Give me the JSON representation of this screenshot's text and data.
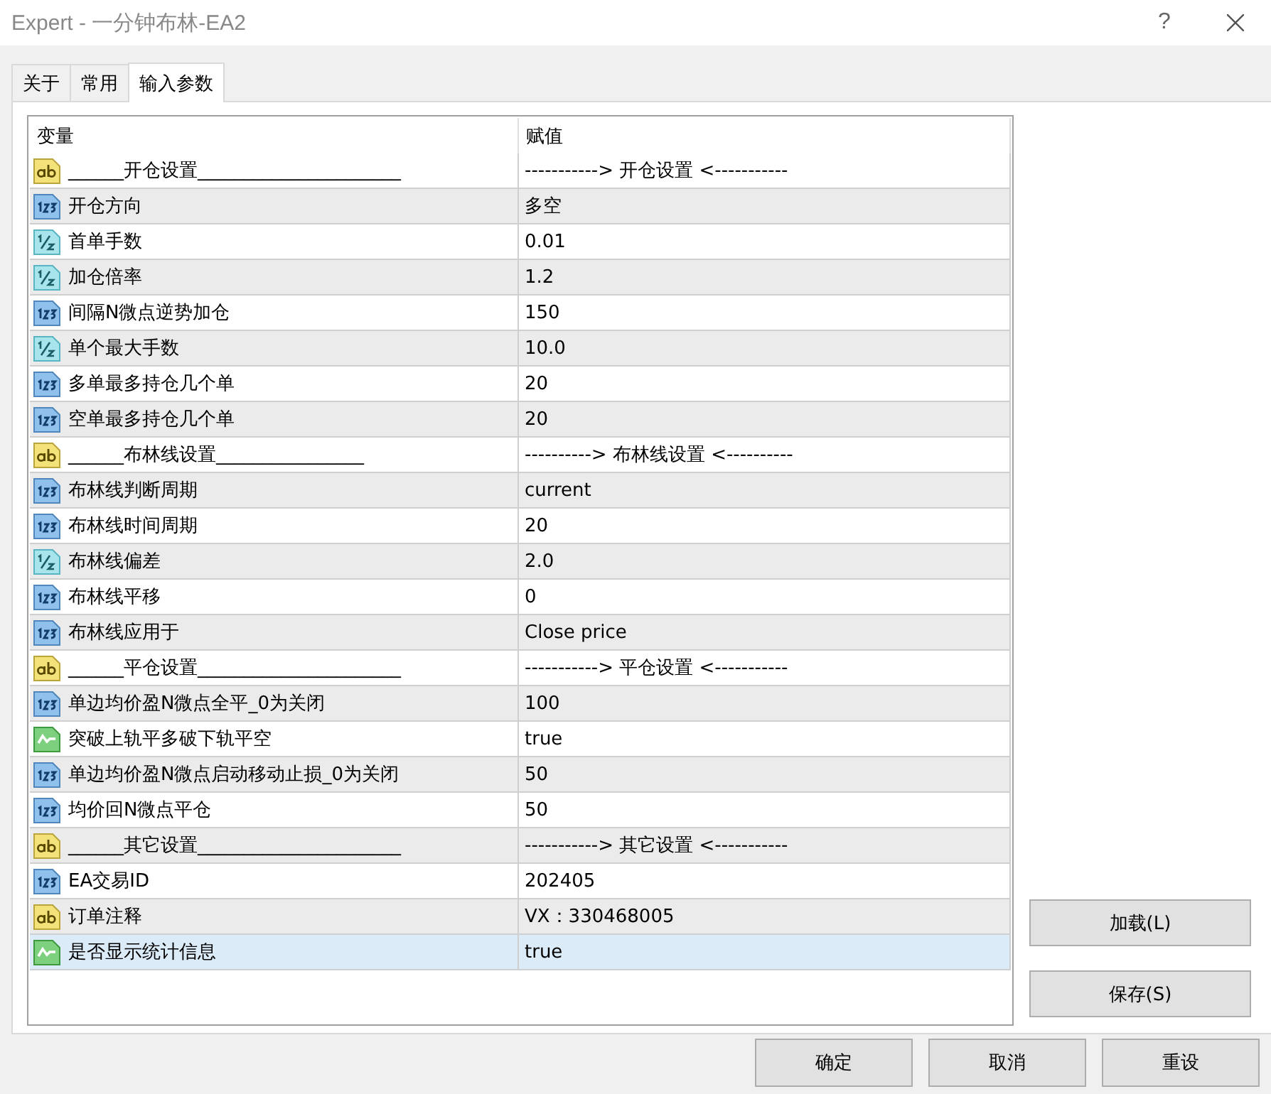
{
  "window": {
    "title": "Expert - 一分钟布林-EA2",
    "help": "?"
  },
  "tabs": [
    {
      "label": "关于",
      "selected": false
    },
    {
      "label": "常用",
      "selected": false
    },
    {
      "label": "输入参数",
      "selected": true
    }
  ],
  "table": {
    "columns": [
      "变量",
      "赋值"
    ],
    "rows": [
      {
        "kind": "string",
        "name": "______开仓设置______________________",
        "value": "-----------> 开仓设置 <-----------",
        "selected": false
      },
      {
        "kind": "int",
        "name": "开仓方向",
        "value": "多空",
        "selected": false
      },
      {
        "kind": "double",
        "name": "首单手数",
        "value": "0.01",
        "selected": false
      },
      {
        "kind": "double",
        "name": "加仓倍率",
        "value": "1.2",
        "selected": false
      },
      {
        "kind": "int",
        "name": "间隔N微点逆势加仓",
        "value": "150",
        "selected": false
      },
      {
        "kind": "double",
        "name": "单个最大手数",
        "value": "10.0",
        "selected": false
      },
      {
        "kind": "int",
        "name": "多单最多持仓几个单",
        "value": "20",
        "selected": false
      },
      {
        "kind": "int",
        "name": "空单最多持仓几个单",
        "value": "20",
        "selected": false
      },
      {
        "kind": "string",
        "name": "______布林线设置________________",
        "value": "----------> 布林线设置 <----------",
        "selected": false
      },
      {
        "kind": "int",
        "name": "布林线判断周期",
        "value": "current",
        "selected": false
      },
      {
        "kind": "int",
        "name": "布林线时间周期",
        "value": "20",
        "selected": false
      },
      {
        "kind": "double",
        "name": "布林线偏差",
        "value": "2.0",
        "selected": false
      },
      {
        "kind": "int",
        "name": "布林线平移",
        "value": "0",
        "selected": false
      },
      {
        "kind": "int",
        "name": "布林线应用于",
        "value": "Close price",
        "selected": false
      },
      {
        "kind": "string",
        "name": "______平仓设置______________________",
        "value": "-----------> 平仓设置 <-----------",
        "selected": false
      },
      {
        "kind": "int",
        "name": "单边均价盈N微点全平_0为关闭",
        "value": "100",
        "selected": false
      },
      {
        "kind": "bool",
        "name": "突破上轨平多破下轨平空",
        "value": "true",
        "selected": false
      },
      {
        "kind": "int",
        "name": "单边均价盈N微点启动移动止损_0为关闭",
        "value": "50",
        "selected": false
      },
      {
        "kind": "int",
        "name": "均价回N微点平仓",
        "value": "50",
        "selected": false
      },
      {
        "kind": "string",
        "name": "______其它设置______________________",
        "value": "-----------> 其它设置 <-----------",
        "selected": false
      },
      {
        "kind": "int",
        "name": "EA交易ID",
        "value": "202405",
        "selected": false
      },
      {
        "kind": "string",
        "name": "订单注释",
        "value": "VX：330468005",
        "selected": false
      },
      {
        "kind": "bool",
        "name": "是否显示统计信息",
        "value": "true",
        "selected": true
      }
    ]
  },
  "side_buttons": [
    "加载(L)",
    "保存(S)"
  ],
  "buttons": [
    "确定",
    "取消",
    "重设"
  ]
}
